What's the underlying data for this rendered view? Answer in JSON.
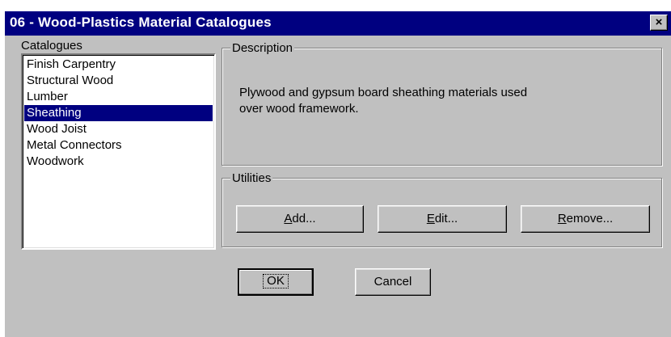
{
  "window": {
    "title": "06 - Wood-Plastics Material Catalogues",
    "close_label": "×"
  },
  "catalogues": {
    "label": "Catalogues",
    "items": [
      {
        "label": "Finish Carpentry",
        "selected": false
      },
      {
        "label": "Structural Wood",
        "selected": false
      },
      {
        "label": "Lumber",
        "selected": false
      },
      {
        "label": "Sheathing",
        "selected": true
      },
      {
        "label": "Wood Joist",
        "selected": false
      },
      {
        "label": "Metal Connectors",
        "selected": false
      },
      {
        "label": "Woodwork",
        "selected": false
      }
    ]
  },
  "description": {
    "label": "Description",
    "text_line1": "Plywood and gypsum board sheathing materials used",
    "text_line2": "over wood framework."
  },
  "utilities": {
    "label": "Utilities",
    "add_mnemonic": "A",
    "add_rest": "dd...",
    "edit_mnemonic": "E",
    "edit_rest": "dit...",
    "remove_mnemonic": "R",
    "remove_rest": "emove..."
  },
  "footer": {
    "ok_label": "OK",
    "cancel_label": "Cancel"
  },
  "colors": {
    "titlebar": "#000080",
    "face": "#c0c0c0",
    "selection": "#000080"
  }
}
